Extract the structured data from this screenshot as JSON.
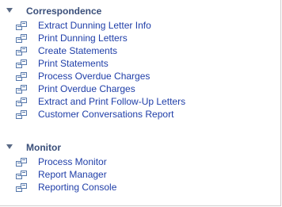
{
  "sections": [
    {
      "title": "Correspondence",
      "items": [
        {
          "label": "Extract Dunning Letter Info"
        },
        {
          "label": "Print Dunning Letters"
        },
        {
          "label": "Create Statements"
        },
        {
          "label": "Print Statements"
        },
        {
          "label": "Process Overdue Charges"
        },
        {
          "label": "Print Overdue Charges"
        },
        {
          "label": "Extract and Print Follow-Up Letters"
        },
        {
          "label": "Customer Conversations Report"
        }
      ]
    },
    {
      "title": "Monitor",
      "items": [
        {
          "label": "Process Monitor"
        },
        {
          "label": "Report Manager"
        },
        {
          "label": "Reporting Console"
        }
      ]
    }
  ],
  "colors": {
    "section_title": "#3a4f7a",
    "link": "#1f3ea8",
    "triangle": "#5a6a85",
    "icon": "#5577aa"
  },
  "icons": {
    "section_toggle": "expanded-triangle-icon",
    "item": "component-link-icon"
  }
}
